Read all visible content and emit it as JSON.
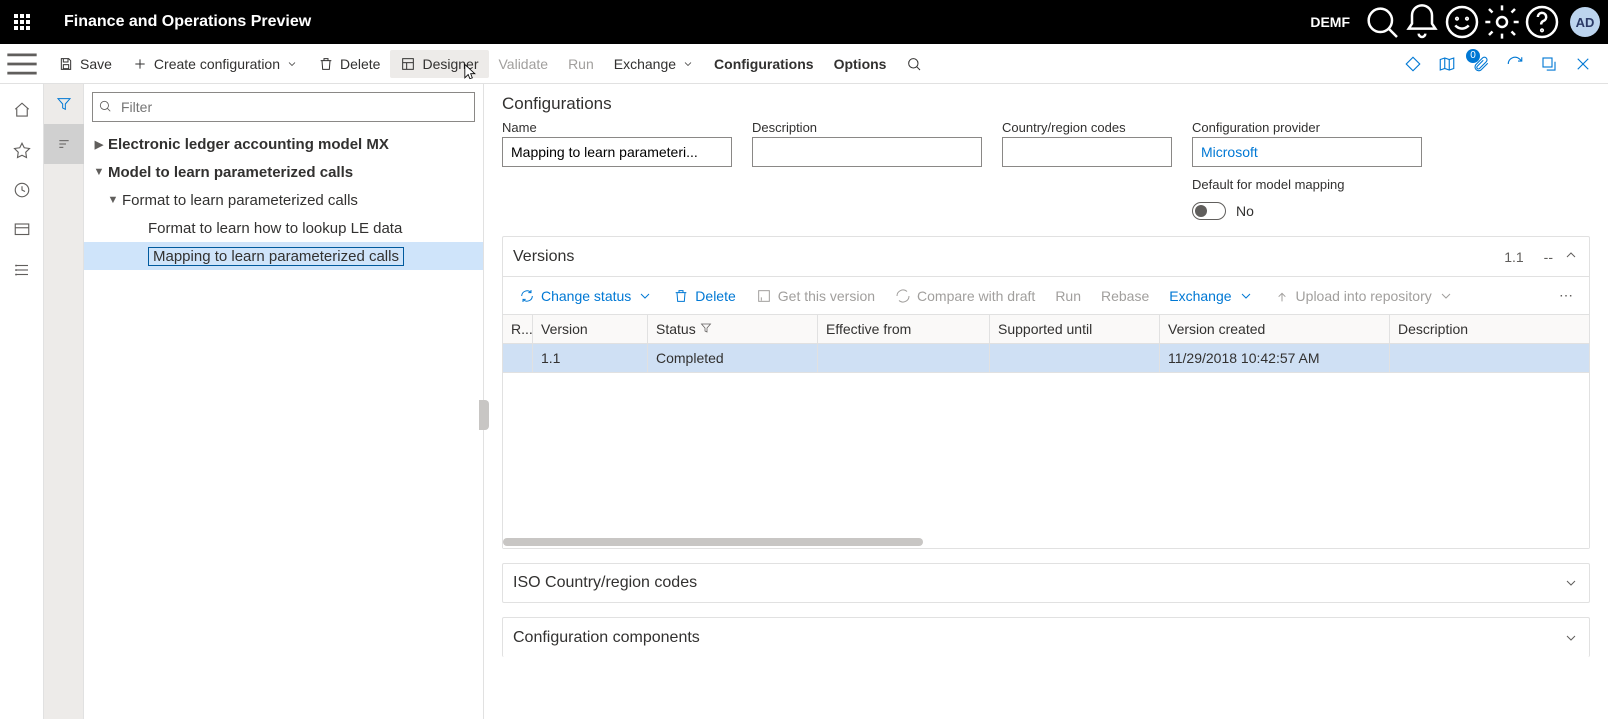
{
  "header": {
    "app_title": "Finance and Operations Preview",
    "company": "DEMF",
    "avatar": "AD"
  },
  "commands": {
    "save": "Save",
    "create_config": "Create configuration",
    "delete": "Delete",
    "designer": "Designer",
    "validate": "Validate",
    "run": "Run",
    "exchange": "Exchange",
    "configurations": "Configurations",
    "options": "Options",
    "attachments_badge": "0"
  },
  "tree": {
    "filter_placeholder": "Filter",
    "nodes": {
      "n0": "Electronic ledger accounting model MX",
      "n1": "Model to learn parameterized calls",
      "n2": "Format to learn parameterized calls",
      "n3": "Format to learn how to lookup LE data",
      "n4": "Mapping to learn parameterized calls"
    }
  },
  "details": {
    "section_title": "Configurations",
    "labels": {
      "name": "Name",
      "description": "Description",
      "country": "Country/region codes",
      "provider": "Configuration provider",
      "default_mapping": "Default for model mapping",
      "no": "No"
    },
    "values": {
      "name": "Mapping to learn parameteri...",
      "description": "",
      "country": "",
      "provider": "Microsoft"
    }
  },
  "versions": {
    "title": "Versions",
    "summary_version": "1.1",
    "summary_dash": "--",
    "toolbar": {
      "change_status": "Change status",
      "delete": "Delete",
      "get_version": "Get this version",
      "compare": "Compare with draft",
      "run": "Run",
      "rebase": "Rebase",
      "exchange": "Exchange",
      "upload": "Upload into repository"
    },
    "columns": {
      "mark": "R...",
      "version": "Version",
      "status": "Status",
      "effective": "Effective from",
      "supported": "Supported until",
      "created": "Version created",
      "description": "Description"
    },
    "rows": [
      {
        "version": "1.1",
        "status": "Completed",
        "effective": "",
        "supported": "",
        "created": "11/29/2018 10:42:57 AM",
        "description": ""
      }
    ]
  },
  "collapsed_sections": {
    "iso": "ISO Country/region codes",
    "components": "Configuration components"
  }
}
